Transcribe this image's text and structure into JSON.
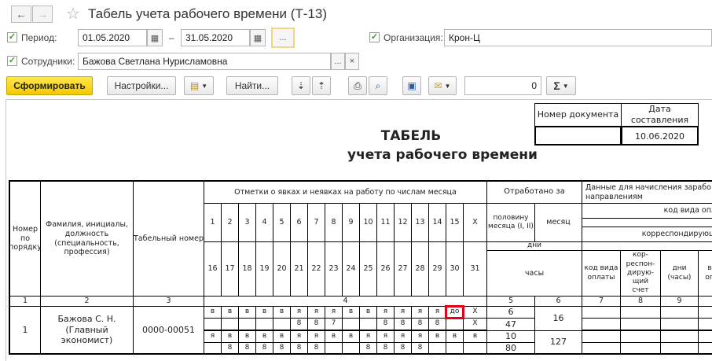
{
  "window": {
    "title": "Табель учета рабочего времени (Т-13)"
  },
  "filters": {
    "period_label": "Период:",
    "period_from": "01.05.2020",
    "period_dash": "–",
    "period_to": "31.05.2020",
    "period_btn": "...",
    "org_label": "Организация:",
    "org_value": "Крон-Ц",
    "emp_label": "Сотрудники:",
    "emp_value": "Бажова Светлана Нурисламовна",
    "emp_btn": "...",
    "emp_clear": "×"
  },
  "toolbar": {
    "generate": "Сформировать",
    "settings": "Настройки...",
    "find": "Найти...",
    "sum_value": "0",
    "sigma": "Σ"
  },
  "report": {
    "doc_num_header": "Номер документа",
    "doc_date_header": "Дата составления",
    "doc_date": "10.06.2020",
    "title1": "ТАБЕЛЬ",
    "title2": "учета  рабочего времени",
    "h_num": "Номер по порядку",
    "h_name": "Фамилия, инициалы, должность (специальность, профессия)",
    "h_tab": "Табельный номер",
    "h_marks": "Отметки о явках и неявках на работу по числам месяца",
    "h_worked": "Отработано за",
    "h_half": "половину месяца (I, II)",
    "h_month": "месяц",
    "h_days": "дни",
    "h_hours": "часы",
    "h_payroll": "Данные для начисления зарабо и направлениям",
    "h_code_type": "код вида опл",
    "h_corr": "корреспондирующ",
    "h_code_pay": "код вида оплаты",
    "h_corr_acc": "кор-респон-дирую-щий счет",
    "h_days_hours": "дни (часы)",
    "h_extra": "ви опл",
    "days_top": [
      "1",
      "2",
      "3",
      "4",
      "5",
      "6",
      "7",
      "8",
      "9",
      "10",
      "11",
      "12",
      "13",
      "14",
      "15",
      "X"
    ],
    "days_bottom": [
      "16",
      "17",
      "18",
      "19",
      "20",
      "21",
      "22",
      "23",
      "24",
      "25",
      "26",
      "27",
      "28",
      "29",
      "30",
      "31"
    ],
    "col_nums": [
      "1",
      "2",
      "3",
      "4",
      "5",
      "6",
      "7",
      "8",
      "9"
    ],
    "row_num": "1",
    "emp_name": "Бажова С. Н. (Главный экономист)",
    "emp_tab": "0000-00051",
    "mark_rows": [
      [
        "в",
        "в",
        "в",
        "в",
        "в",
        "я",
        "я",
        "я",
        "в",
        "в",
        "я",
        "я",
        "я",
        "я",
        "до",
        "X"
      ],
      [
        "",
        "",
        "",
        "",
        "",
        "8",
        "8",
        "7",
        "",
        "",
        "8",
        "8",
        "8",
        "8",
        "",
        "X"
      ],
      [
        "я",
        "в",
        "в",
        "в",
        "в",
        "я",
        "я",
        "в",
        "в",
        "я",
        "я",
        "я",
        "я",
        "в",
        "в",
        "в"
      ],
      [
        "",
        "8",
        "8",
        "8",
        "8",
        "8",
        "8",
        "",
        "",
        "8",
        "8",
        "8",
        "8",
        "",
        "",
        ""
      ]
    ],
    "half1_days": "6",
    "half1_hours": "47",
    "half2_days": "10",
    "half2_hours": "80",
    "month_days": "16",
    "month_hours": "127"
  },
  "colors": {
    "highlight": "#e0001a",
    "primary_btn": "#f5c800",
    "check": "#3a9a2a"
  }
}
